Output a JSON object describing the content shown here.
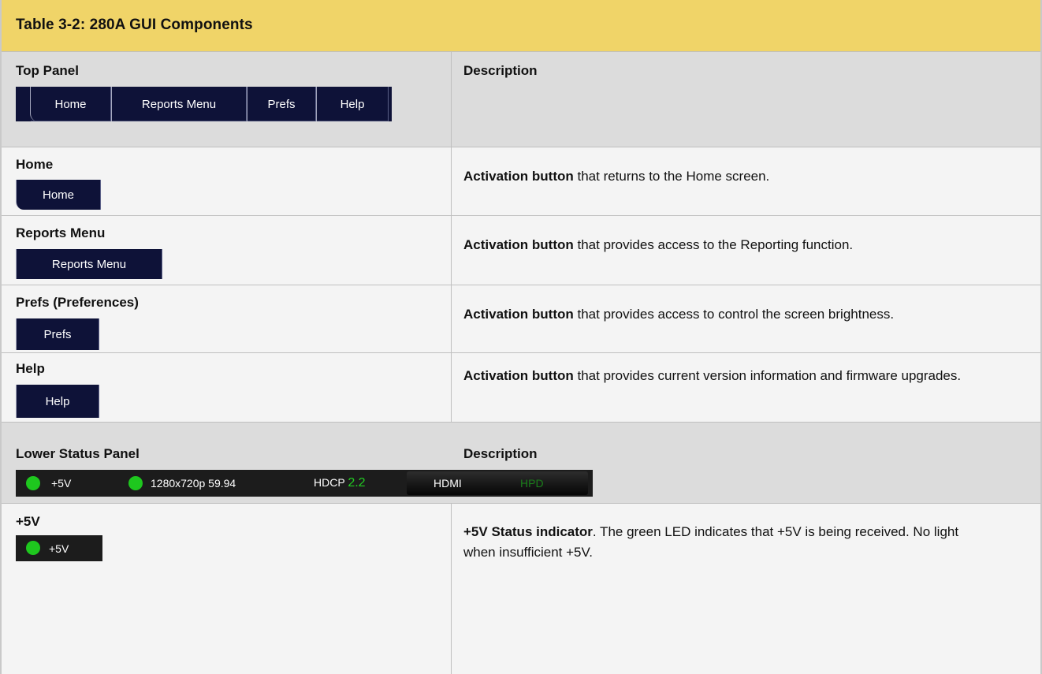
{
  "table": {
    "title": "Table 3-2: 280A GUI Components",
    "top_panel": {
      "header_left": "Top Panel",
      "header_right": "Description",
      "tabs": [
        "Home",
        "Reports Menu",
        "Prefs",
        "Help"
      ]
    },
    "rows": [
      {
        "name": "Home",
        "button": "Home",
        "desc_bold": "Activation button",
        "desc_rest": " that returns to the Home screen."
      },
      {
        "name": "Reports Menu",
        "button": "Reports Menu",
        "desc_bold": "Activation button",
        "desc_rest": " that provides access to the Reporting function."
      },
      {
        "name": "Prefs (Preferences)",
        "button": "Prefs",
        "desc_bold": "Activation button",
        "desc_rest": " that provides access to control the screen brightness."
      },
      {
        "name": "Help",
        "button": "Help",
        "desc_bold": "Activation button",
        "desc_rest": " that provides current version information and firmware upgrades."
      }
    ],
    "lower_panel": {
      "header_left": "Lower Status Panel",
      "header_right": "Description",
      "status": {
        "v5": "+5V",
        "resolution": "1280x720p 59.94",
        "hdcp_label": "HDCP",
        "hdcp_value": "2.2",
        "hdmi": "HDMI",
        "hpd": "HPD"
      }
    },
    "v5_row": {
      "name": "+5V",
      "indicator": "+5V",
      "desc_bold": "+5V Status indicator",
      "desc_rest": ". The green LED indicates that +5V is being received. No light when insufficient +5V."
    }
  },
  "colors": {
    "title_bg": "#f0d468",
    "header_bg": "#dcdcdc",
    "row_bg": "#f4f4f4",
    "tab_bg": "#0e1238",
    "led": "#1ec71e"
  }
}
